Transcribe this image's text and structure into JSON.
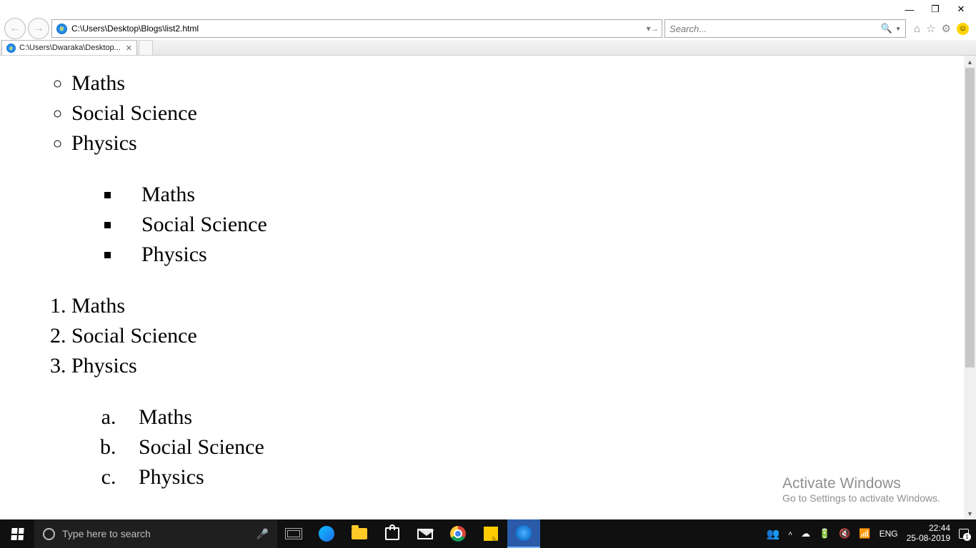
{
  "window_controls": {
    "min": "—",
    "max": "❐",
    "close": "✕"
  },
  "address_bar": {
    "url": "C:\\Users\\Desktop\\Blogs\\list2.html",
    "refresh_glyph": "↻",
    "go_glyph": "→"
  },
  "search": {
    "placeholder": "Search...",
    "mag_glyph": "🔍▾"
  },
  "right_icons": {
    "home": "⌂",
    "star": "☆",
    "gear": "⚙"
  },
  "tab": {
    "title": "C:\\Users\\Dwaraka\\Desktop..."
  },
  "lists": {
    "circle": [
      "Maths",
      "Social Science",
      "Physics"
    ],
    "square": [
      "Maths",
      "Social Science",
      "Physics"
    ],
    "decimal": [
      "Maths",
      "Social Science",
      "Physics"
    ],
    "alpha": [
      "Maths",
      "Social Science",
      "Physics"
    ]
  },
  "watermark": {
    "line1": "Activate Windows",
    "line2": "Go to Settings to activate Windows."
  },
  "taskbar": {
    "search_placeholder": "Type here to search",
    "lang": "ENG",
    "time": "22:44",
    "date": "25-08-2019"
  }
}
